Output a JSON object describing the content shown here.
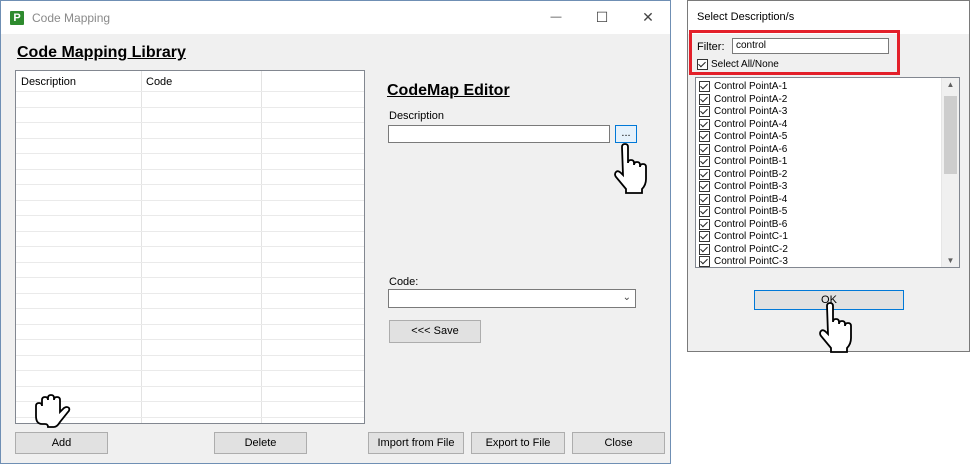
{
  "main": {
    "title": "Code Mapping",
    "logo_letter": "P",
    "library_heading": "Code Mapping Library",
    "grid": {
      "columns": [
        "Description",
        "Code"
      ]
    },
    "editor_heading": "CodeMap Editor",
    "description_label": "Description",
    "description_value": "",
    "browse_label": "...",
    "code_label": "Code:",
    "code_value": "",
    "save_label": "<<< Save",
    "buttons": {
      "add": "Add",
      "delete": "Delete",
      "import": "Import from File",
      "export": "Export to File",
      "close": "Close"
    },
    "window_controls": {
      "minimize": "—",
      "maximize": "☐",
      "close": "✕"
    }
  },
  "dialog": {
    "title": "Select Description/s",
    "filter_label": "Filter:",
    "filter_value": "control",
    "select_all_label": "Select All/None",
    "select_all_checked": true,
    "items": [
      "Control PointA-1",
      "Control PointA-2",
      "Control PointA-3",
      "Control PointA-4",
      "Control PointA-5",
      "Control PointA-6",
      "Control PointB-1",
      "Control PointB-2",
      "Control PointB-3",
      "Control PointB-4",
      "Control PointB-5",
      "Control PointB-6",
      "Control PointC-1",
      "Control PointC-2",
      "Control PointC-3"
    ],
    "ok_label": "OK"
  },
  "colors": {
    "highlight_box": "#e3202a",
    "focus_border": "#0078d7",
    "logo_green": "#2e8b2e"
  }
}
